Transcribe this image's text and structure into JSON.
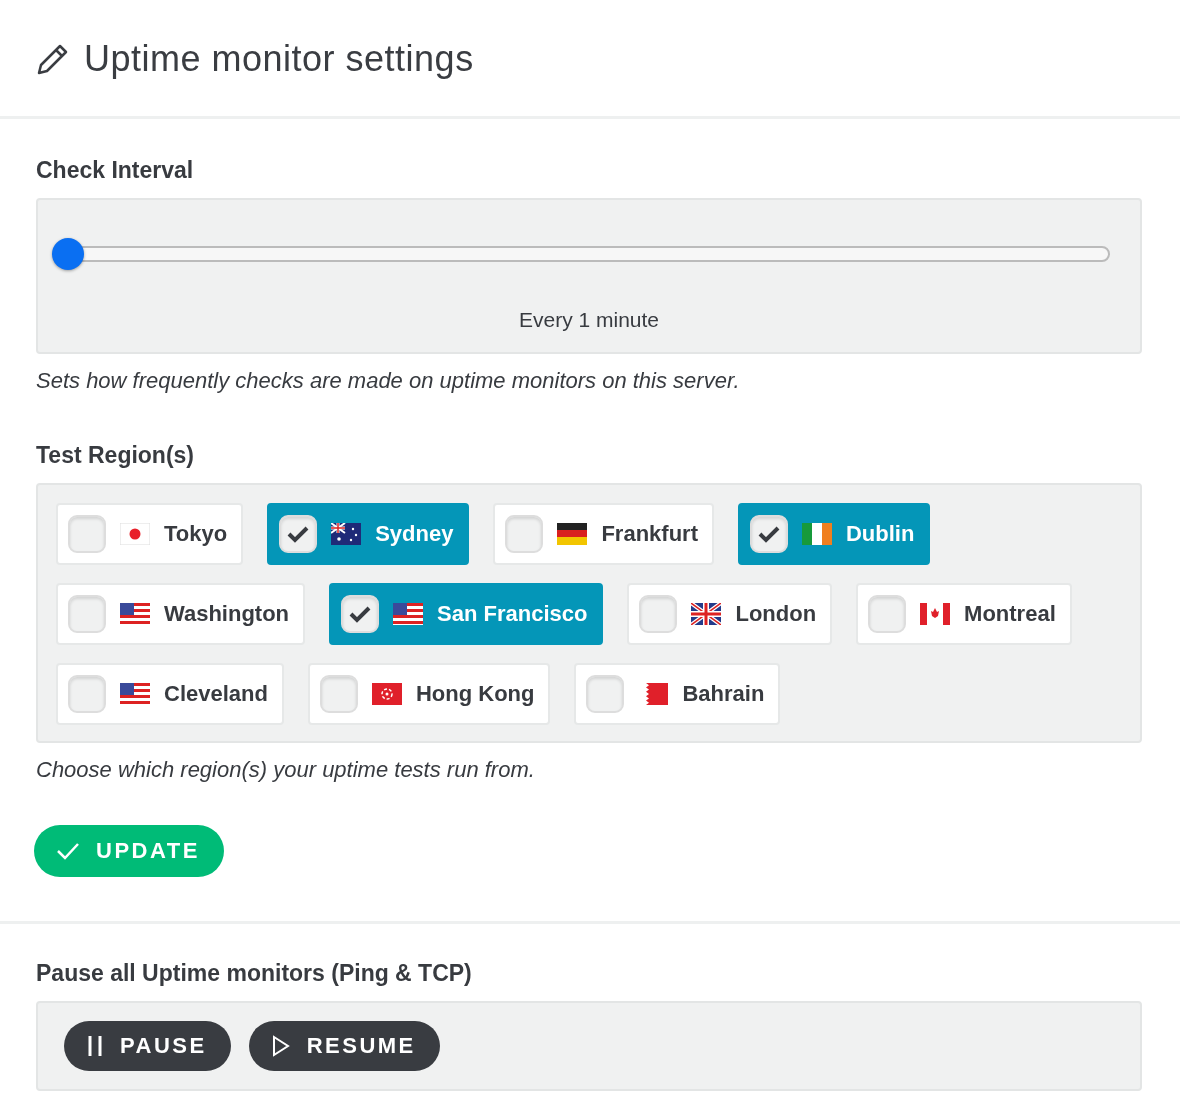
{
  "header": {
    "title": "Uptime monitor settings"
  },
  "check_interval": {
    "label": "Check Interval",
    "slider": {
      "level": 0
    },
    "reading": "Every 1 minute",
    "help": "Sets how frequently checks are made on uptime monitors on this server."
  },
  "test_regions": {
    "label": "Test Region(s)",
    "regions": [
      {
        "name": "Tokyo",
        "kind": "jp",
        "checked": false
      },
      {
        "name": "Sydney",
        "kind": "au",
        "checked": true
      },
      {
        "name": "Frankfurt",
        "kind": "de",
        "checked": false
      },
      {
        "name": "Dublin",
        "kind": "ie",
        "checked": true
      },
      {
        "name": "Washington",
        "kind": "us",
        "checked": false
      },
      {
        "name": "San Francisco",
        "kind": "us",
        "checked": true
      },
      {
        "name": "London",
        "kind": "gb",
        "checked": false
      },
      {
        "name": "Montreal",
        "kind": "ca",
        "checked": false
      },
      {
        "name": "Cleveland",
        "kind": "us",
        "checked": false
      },
      {
        "name": "Hong Kong",
        "kind": "hk",
        "checked": false
      },
      {
        "name": "Bahrain",
        "kind": "bh",
        "checked": false
      }
    ],
    "help": "Choose which region(s) your uptime tests run from."
  },
  "update_button": {
    "label": "UPDATE"
  },
  "pause_section": {
    "label": "Pause all Uptime monitors (Ping & TCP)",
    "buttons": [
      {
        "label": "PAUSE",
        "kind": "pause"
      },
      {
        "label": "RESUME",
        "kind": "resume"
      }
    ]
  }
}
